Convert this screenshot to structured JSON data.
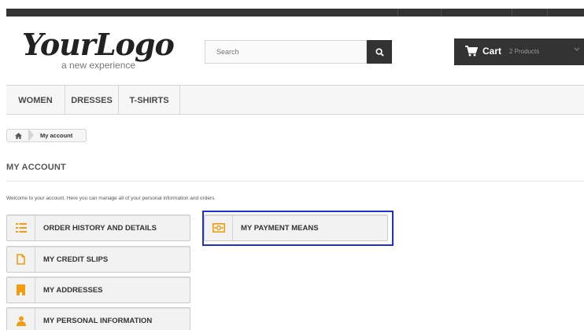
{
  "header": {
    "logo_text": "YourLogo",
    "logo_tagline": "a new experience",
    "search": {
      "placeholder": "Search"
    },
    "cart": {
      "label": "Cart",
      "count": "2 Products"
    }
  },
  "menu": {
    "items": [
      {
        "label": "WOMEN"
      },
      {
        "label": "DRESSES"
      },
      {
        "label": "T-SHIRTS"
      }
    ]
  },
  "breadcrumb": {
    "current": "My account"
  },
  "page": {
    "title": "MY ACCOUNT",
    "welcome": "Welcome to your account. Here you can manage all of your personal information and orders."
  },
  "account_links": [
    {
      "label": "ORDER HISTORY AND DETAILS",
      "icon": "list-icon"
    },
    {
      "label": "MY CREDIT SLIPS",
      "icon": "file-icon"
    },
    {
      "label": "MY ADDRESSES",
      "icon": "building-icon"
    },
    {
      "label": "MY PERSONAL INFORMATION",
      "icon": "user-icon"
    },
    {
      "label": "MY PAYMENT MEANS",
      "icon": "money-icon"
    }
  ],
  "colors": {
    "accent_orange": "#f39c11",
    "dark_bar": "#333333",
    "highlight_border": "#1f2fd6"
  }
}
